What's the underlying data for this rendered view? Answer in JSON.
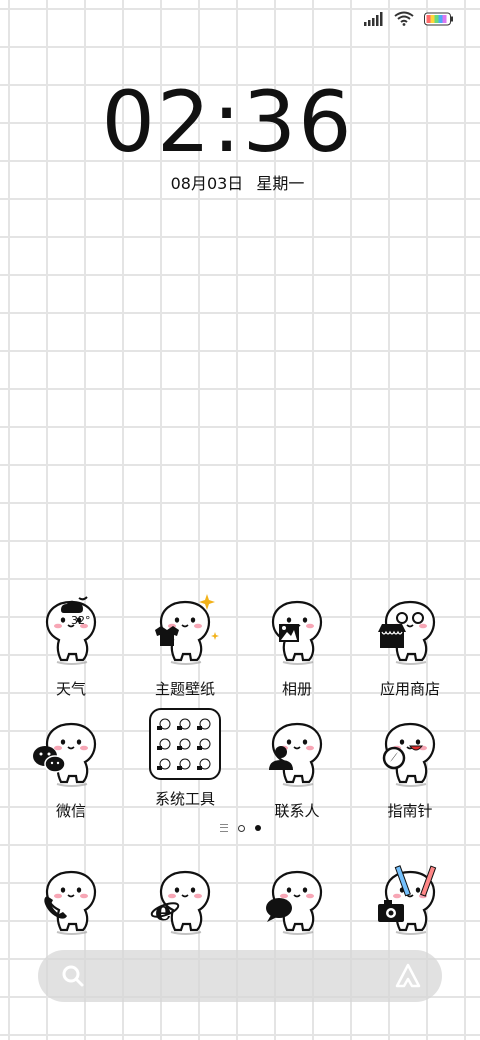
{
  "status_bar": {
    "icons": [
      "signal-icon",
      "wifi-icon",
      "battery-icon"
    ]
  },
  "clock": {
    "time": "02:36",
    "date": "08月03日",
    "weekday": "星期一"
  },
  "apps": [
    {
      "label": "天气",
      "icon": "weather-icon",
      "badge_text": "32°"
    },
    {
      "label": "主题壁纸",
      "icon": "theme-icon"
    },
    {
      "label": "相册",
      "icon": "gallery-icon"
    },
    {
      "label": "应用商店",
      "icon": "app-store-icon"
    },
    {
      "label": "微信",
      "icon": "wechat-icon"
    },
    {
      "label": "系统工具",
      "icon": "system-tools-folder-icon"
    },
    {
      "label": "联系人",
      "icon": "contacts-icon"
    },
    {
      "label": "指南针",
      "icon": "compass-icon"
    }
  ],
  "dock": [
    {
      "icon": "phone-icon"
    },
    {
      "icon": "browser-icon"
    },
    {
      "icon": "messages-icon"
    },
    {
      "icon": "camera-icon"
    }
  ],
  "page_indicator": {
    "pages": 2,
    "current": 2
  },
  "colors": {
    "grid": "#e4e4e4",
    "blush": "#f7a6b5",
    "star": "#f2b21a",
    "search_bg": "#d7d7d7"
  }
}
